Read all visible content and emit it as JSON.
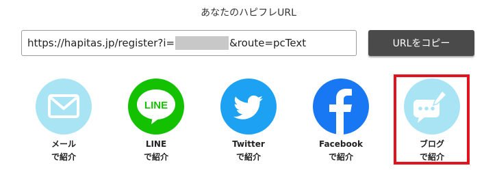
{
  "header": {
    "title": "あなたのハピフレURL"
  },
  "url_box": {
    "prefix": "https://hapitas.jp/register?i=",
    "suffix": "&route=pcText"
  },
  "copy_button": {
    "label": "URLをコピー"
  },
  "share_options": [
    {
      "line1": "メール",
      "line2": "で紹介",
      "icon": "mail-icon",
      "color": "#a9e4f4"
    },
    {
      "line1": "LINE",
      "line2": "で紹介",
      "icon": "line-icon",
      "icon_text": "LINE",
      "color": "#14c100"
    },
    {
      "line1": "Twitter",
      "line2": "で紹介",
      "icon": "twitter-icon",
      "color": "#1da1f2"
    },
    {
      "line1": "Facebook",
      "line2": "で紹介",
      "icon": "facebook-icon",
      "color": "#1877f2"
    },
    {
      "line1": "ブログ",
      "line2": "で紹介",
      "icon": "blog-icon",
      "color": "#a9e4f4"
    }
  ],
  "colors": {
    "highlight": "#e1141e",
    "button": "#4a4a4a"
  }
}
